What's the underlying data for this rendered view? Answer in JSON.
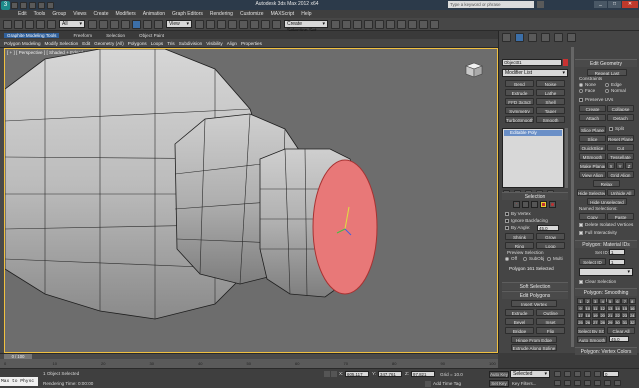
{
  "app": {
    "title": "Autodesk 3ds Max 2012 x64",
    "search_placeholder": "Type a keyword or phrase"
  },
  "menu": [
    "Edit",
    "Tools",
    "Group",
    "Views",
    "Create",
    "Modifiers",
    "Animation",
    "Graph Editors",
    "Rendering",
    "Customize",
    "MAXScript",
    "Help"
  ],
  "toolbar": {
    "select_filter": "All",
    "ref_coord": "View",
    "named_sets": "Create Selection Set"
  },
  "ribbon": {
    "tabs": [
      "Graphite Modeling Tools",
      "Freeform",
      "Selection",
      "Object Paint"
    ],
    "subtabs": [
      "Polygon Modeling",
      "Modify Selection",
      "Edit",
      "Geometry (All)",
      "Polygons",
      "Loops",
      "Tris",
      "Subdivision",
      "Visibility",
      "Align",
      "Properties"
    ]
  },
  "viewport": {
    "label": "[ + ] [ Perspective ] [ Shaded + Edged Faces ]",
    "colors": {
      "bg": "#6d6d6d",
      "sel": "#e87878"
    }
  },
  "panel": {
    "object_name": "Object01",
    "modifier_list": "Modifier List",
    "modifier_buttons": [
      "Bend",
      "Noise",
      "Extrude",
      "Lathe",
      "FFD 3x3x3",
      "Shell",
      "Symmetry",
      "Taper",
      "TurboSmooth",
      "Smooth"
    ],
    "stack_item": "Editable Poly"
  },
  "selection": {
    "title": "Selection",
    "by_vertex": "By Vertex",
    "ignore_backfacing": "Ignore Backfacing",
    "by_angle": "By Angle:",
    "by_angle_val": "45.0",
    "shrink": "Shrink",
    "grow": "Grow",
    "ring": "Ring",
    "loop": "Loop",
    "preview_title": "Preview Selection",
    "preview_opts": [
      "Off",
      "SubObj",
      "Multi"
    ],
    "status": "Polygon 161 Selected"
  },
  "soft_selection": "Soft Selection",
  "edit_polygons": {
    "title": "Edit Polygons",
    "insert_vertex": "Insert Vertex",
    "buttons": [
      "Extrude",
      "Outline",
      "Bevel",
      "Inset",
      "Bridge",
      "Flip"
    ],
    "hinge": "Hinge From Edge",
    "extrude_spline": "Extrude Along Spline",
    "edit_tri": "Edit Triangulation",
    "retriangulate": "Retriangulate",
    "turn": "Turn"
  },
  "edit_geometry": {
    "title": "Edit Geometry",
    "repeat_last": "Repeat Last",
    "constraints": "Constraints",
    "constraint_opts": [
      "None",
      "Edge",
      "Face",
      "Normal"
    ],
    "preserve_uvs": "Preserve UVs",
    "pairs": [
      [
        "Create",
        "Collapse"
      ],
      [
        "Attach",
        "Detach"
      ]
    ],
    "slice_plane": "Slice Plane",
    "split": "Split",
    "slice": "Slice",
    "reset_plane": "Reset Plane",
    "quickslice": "QuickSlice",
    "cut": "Cut",
    "msmooth": "MSmooth",
    "tessellate": "Tessellate",
    "make_planar": "Make Planar",
    "axes": [
      "X",
      "Y",
      "Z"
    ],
    "view_align": "View Align",
    "grid_align": "Grid Align",
    "relax": "Relax",
    "hide_selected": "Hide Selected",
    "unhide_all": "Unhide All",
    "hide_unselected": "Hide Unselected",
    "named_selections": "Named Selections:",
    "copy": "Copy",
    "paste": "Paste",
    "delete_isolated": "Delete Isolated Vertices",
    "full_interactivity": "Full Interactivity"
  },
  "material_ids": {
    "title": "Polygon: Material IDs",
    "set_id": "Set ID:",
    "set_id_val": "1",
    "select_id": "Select ID",
    "select_id_val": "1",
    "clear_selection": "Clear Selection"
  },
  "smoothing": {
    "title": "Polygon: Smoothing Groups",
    "groups": [
      "1",
      "2",
      "3",
      "4",
      "5",
      "6",
      "7",
      "8",
      "9",
      "10",
      "11",
      "12",
      "13",
      "14",
      "15",
      "16",
      "17",
      "18",
      "19",
      "20",
      "21",
      "22",
      "23",
      "24",
      "25",
      "26",
      "27",
      "28",
      "29",
      "30",
      "31",
      "32"
    ],
    "select_by_sg": "Select By SG",
    "clear_all": "Clear All",
    "auto_smooth": "Auto Smooth",
    "auto_smooth_val": "45.0"
  },
  "vertex_colors": {
    "title": "Polygon: Vertex Colors",
    "color": "Color:"
  },
  "timeline": {
    "slider": "0 / 100",
    "ticks": [
      "0",
      "10",
      "20",
      "30",
      "40",
      "50",
      "60",
      "70",
      "80",
      "90",
      "100"
    ]
  },
  "status": {
    "listener": "Max to Physc",
    "objects": "1 Object Selected",
    "rendering_time": "Rendering Time: 0:00:00",
    "x": "605.117",
    "y": "347.761",
    "z": "97.821",
    "grid": "Grid = 10.0",
    "auto_key": "Auto Key",
    "selected": "Selected",
    "set_key": "Set Key",
    "key_filters": "Key Filters...",
    "add_time_tag": "Add Time Tag",
    "frame": "0"
  }
}
